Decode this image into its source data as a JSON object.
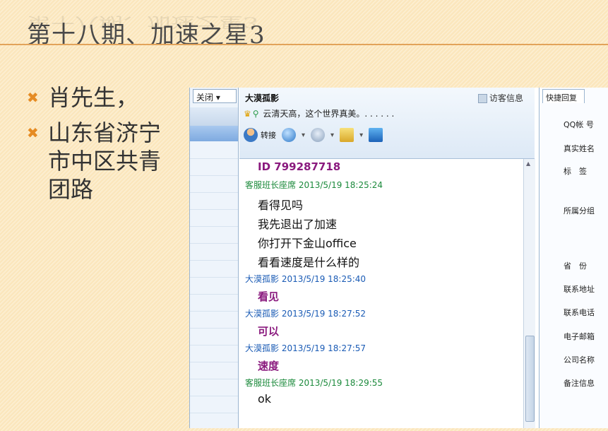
{
  "slide": {
    "title": "第十八期、加速之星3",
    "bullets": [
      "肖先生，",
      "山东省济宁市中区共青团路"
    ]
  },
  "screenshot": {
    "left_panel": {
      "select_value": "关闭"
    },
    "chat": {
      "contact_name": "大漠孤影",
      "visitor_info": "访客信息",
      "status_text": "云清天高，这个世界真美。. . . . . .",
      "transfer_label": "转接",
      "messages": [
        {
          "kind": "body-purple",
          "text": "ID 799287718"
        },
        {
          "kind": "meta-green",
          "text": "客服班长座席 2013/5/19 18:25:24"
        },
        {
          "kind": "body",
          "text": "看得见吗"
        },
        {
          "kind": "body",
          "text": "我先退出了加速"
        },
        {
          "kind": "body",
          "text": "你打开下金山office"
        },
        {
          "kind": "body",
          "text": "看看速度是什么样的"
        },
        {
          "kind": "meta-blue",
          "text": "大漠孤影 2013/5/19 18:25:40"
        },
        {
          "kind": "body-purple",
          "text": "看见"
        },
        {
          "kind": "meta-blue",
          "text": "大漠孤影 2013/5/19 18:27:52"
        },
        {
          "kind": "body-purple",
          "text": "可以"
        },
        {
          "kind": "meta-blue",
          "text": "大漠孤影 2013/5/19 18:27:57"
        },
        {
          "kind": "body-purple",
          "text": "速度"
        },
        {
          "kind": "meta-green",
          "text": "客服班长座席 2013/5/19 18:29:55"
        },
        {
          "kind": "body",
          "text": "ok"
        }
      ]
    },
    "right_panel": {
      "tab": "快捷回复",
      "labels": [
        "QQ帐 号",
        "真实姓名",
        "标　签",
        "所属分组",
        "省　份",
        "联系地址",
        "联系电话",
        "电子邮箱",
        "公司名称",
        "备注信息"
      ]
    }
  }
}
